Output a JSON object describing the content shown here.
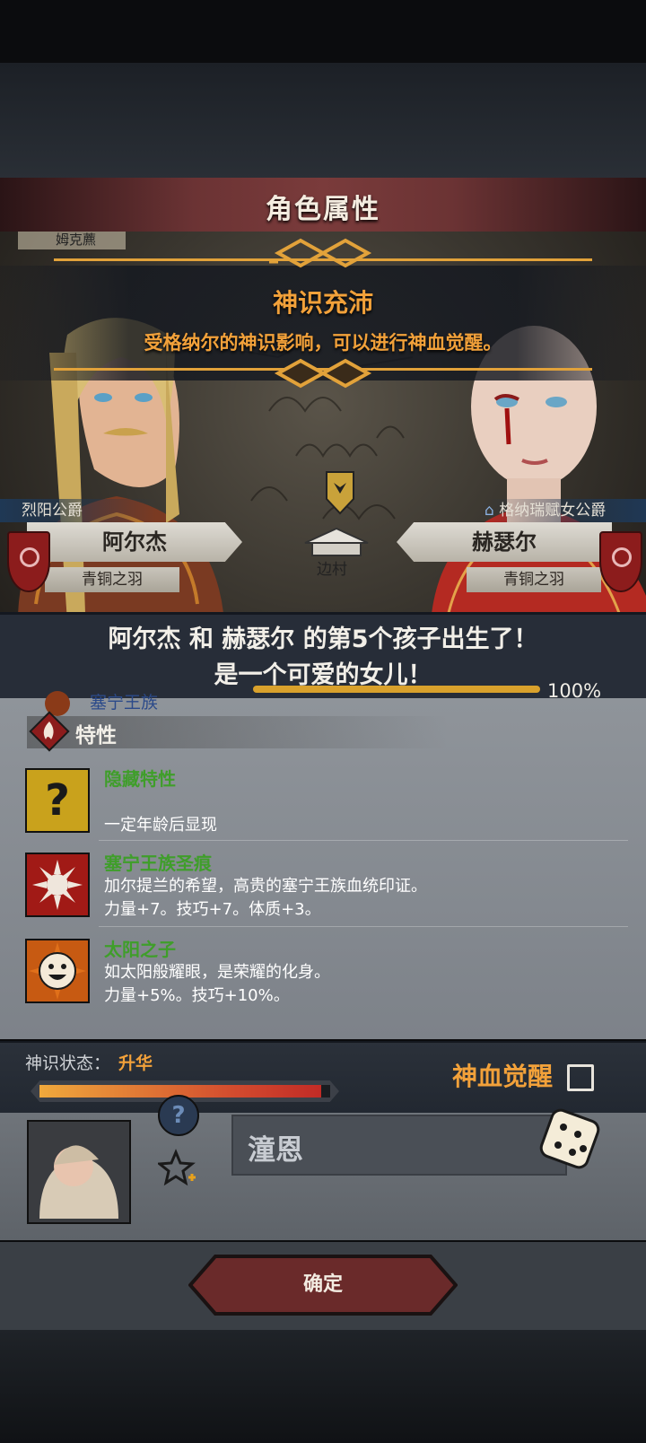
{
  "header": {
    "title": "角色属性"
  },
  "banner": {
    "title": "神识充沛",
    "description": "受格纳尔的神识影响，可以进行神血觉醒。"
  },
  "map": {
    "corner_label": "姆克藨",
    "village_label": "边村"
  },
  "father": {
    "title": "烈阳公爵",
    "name": "阿尔杰",
    "subtitle": "青铜之羽"
  },
  "mother": {
    "title": "格纳瑞赋女公爵",
    "name": "赫瑟尔",
    "subtitle": "青铜之羽"
  },
  "birth_message": {
    "line1": "阿尔杰 和 赫瑟尔 的第5个孩子出生了！",
    "line2": "是一个可爱的女儿！"
  },
  "lineage": {
    "name": "塞宁王族",
    "percent": "100%",
    "progress": 1.0
  },
  "traits_section": {
    "title": "特性"
  },
  "traits": [
    {
      "name": "隐藏特性",
      "line1": "",
      "line2": "一定年龄后显现",
      "icon": "question-icon"
    },
    {
      "name": "塞宁王族圣痕",
      "line1": "加尔提兰的希望，高贵的塞宁王族血统印证。",
      "line2": "力量+7。技巧+7。体质+3。",
      "icon": "white-sun-icon"
    },
    {
      "name": "太阳之子",
      "line1": "如太阳般耀眼，是荣耀的化身。",
      "line2": "力量+5%。技巧+10%。",
      "icon": "smiling-sun-icon"
    }
  ],
  "divine_status": {
    "label": "神识状态：",
    "value": "升华",
    "progress": 0.97
  },
  "awakening": {
    "label": "神血觉醒",
    "checked": false
  },
  "child": {
    "name": "潼恩"
  },
  "confirm": {
    "label": "确定"
  },
  "colors": {
    "accent_orange": "#f2a13a",
    "trait_green": "#3f9e2a",
    "banner_red": "#7a3b3b",
    "shield_red": "#8c1c1c"
  }
}
